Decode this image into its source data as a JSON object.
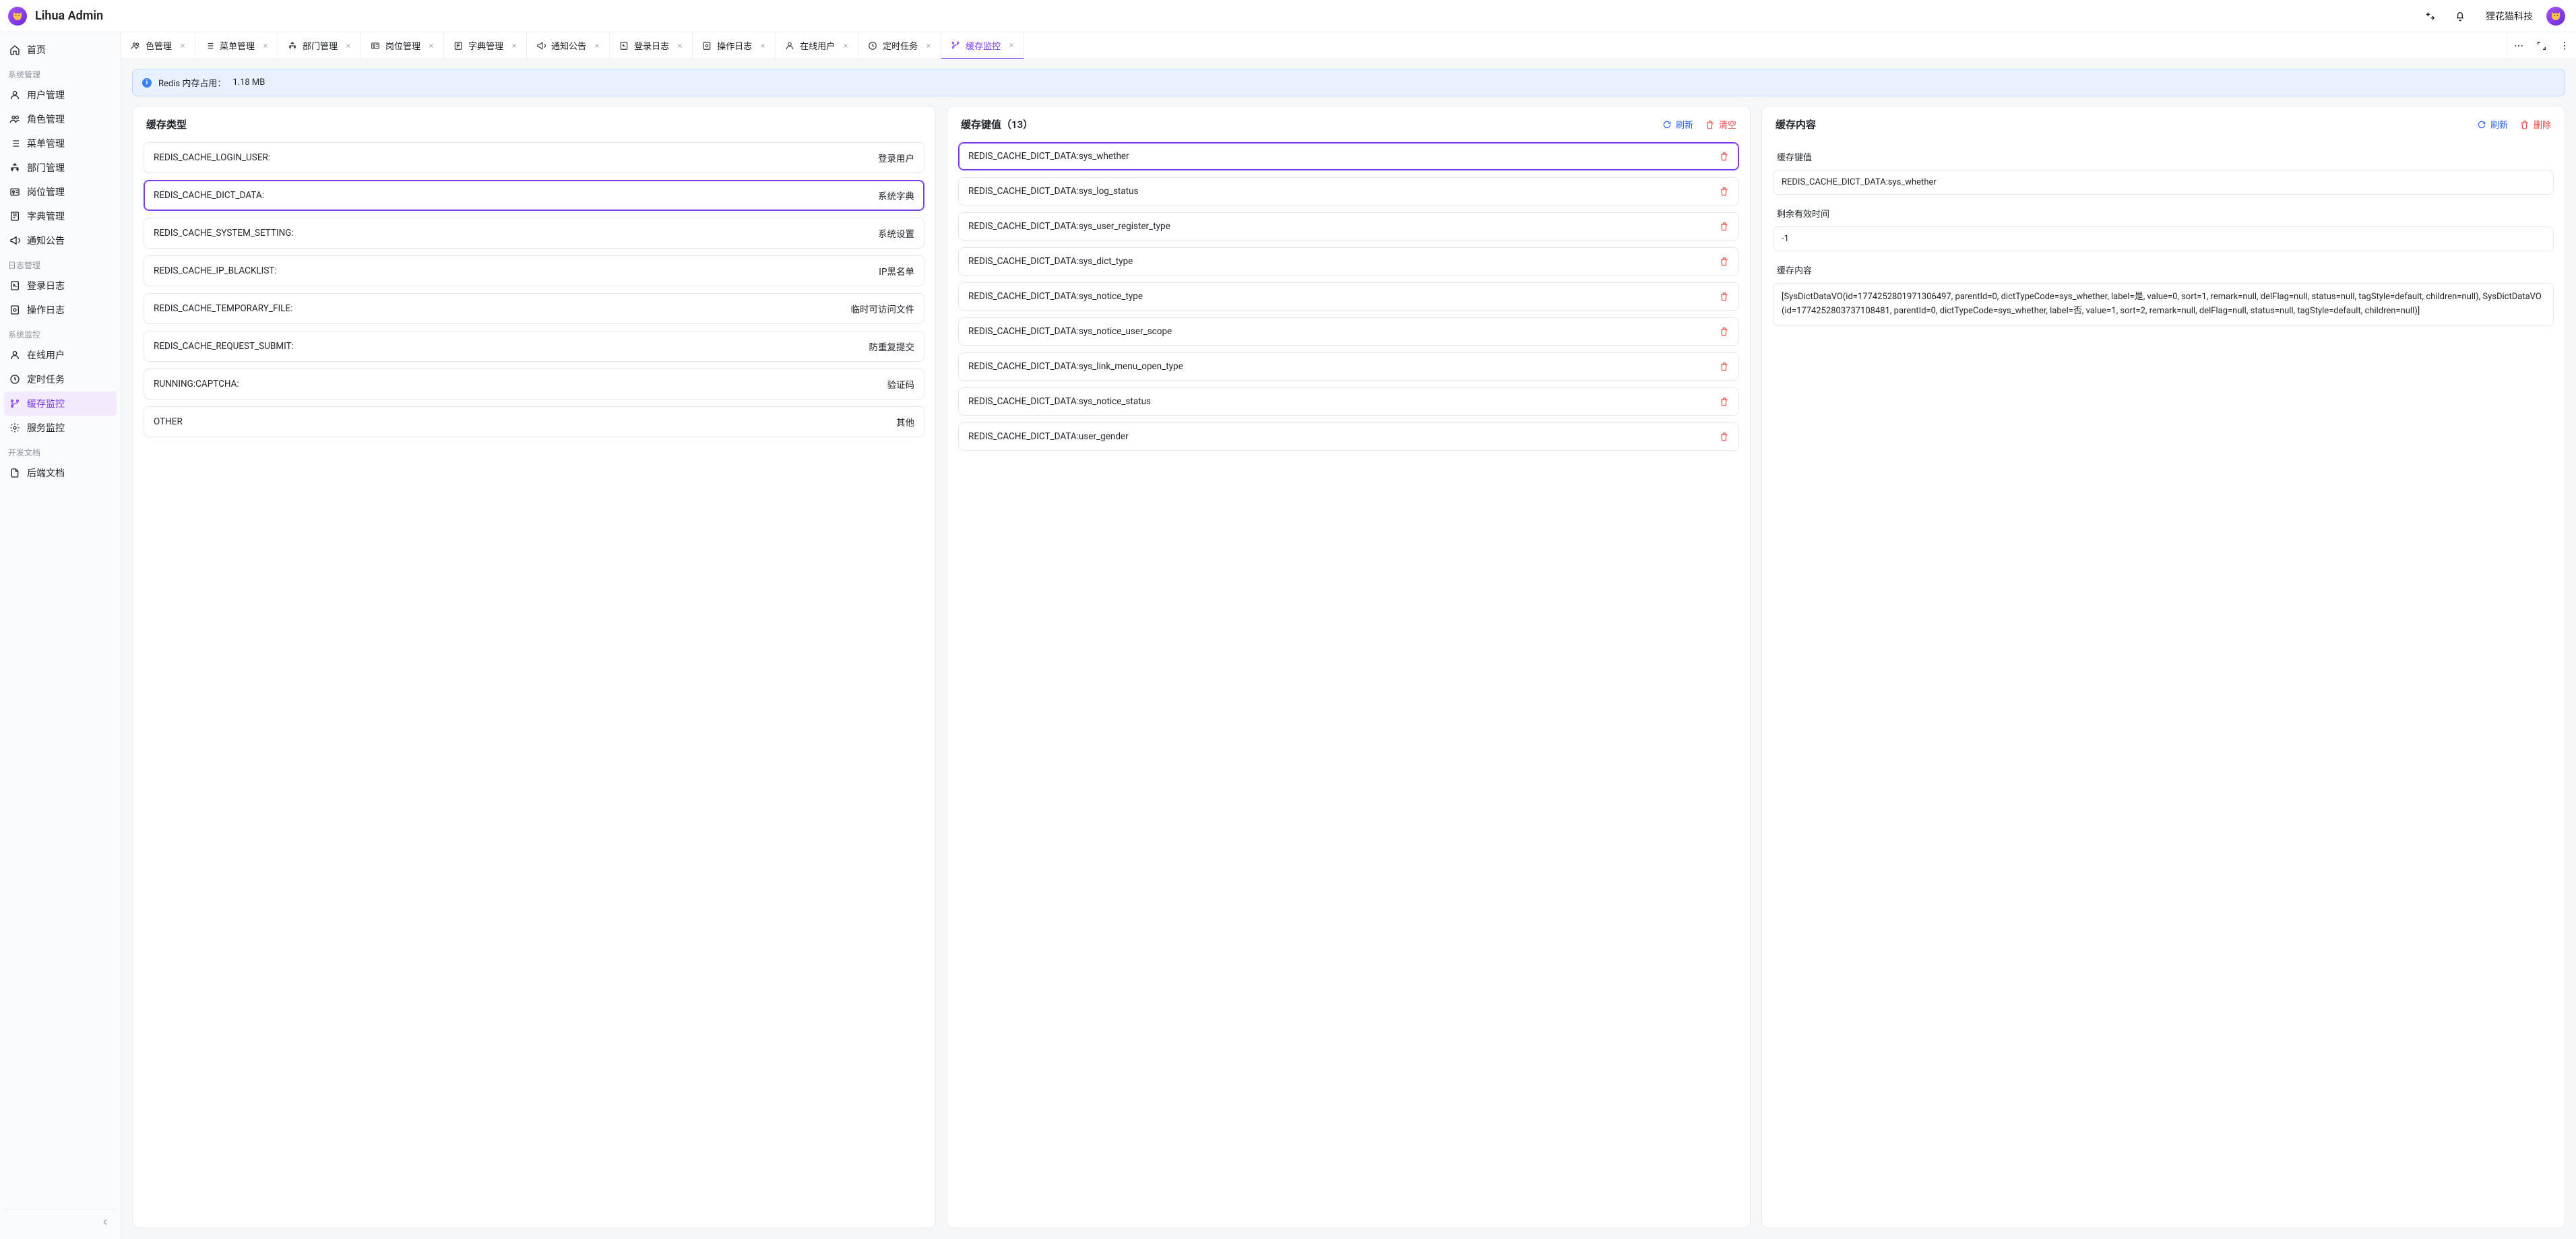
{
  "app": {
    "name": "Lihua Admin",
    "org_name": "狸花猫科技"
  },
  "sidebar": {
    "groups": [
      {
        "title": "",
        "items": [
          {
            "key": "home",
            "label": "首页",
            "icon": "home-icon"
          }
        ]
      },
      {
        "title": "系统管理",
        "items": [
          {
            "key": "user-mgmt",
            "label": "用户管理",
            "icon": "user-icon"
          },
          {
            "key": "role-mgmt",
            "label": "角色管理",
            "icon": "team-icon"
          },
          {
            "key": "menu-mgmt",
            "label": "菜单管理",
            "icon": "list-icon"
          },
          {
            "key": "dept-mgmt",
            "label": "部门管理",
            "icon": "org-icon"
          },
          {
            "key": "post-mgmt",
            "label": "岗位管理",
            "icon": "id-icon"
          },
          {
            "key": "dict-mgmt",
            "label": "字典管理",
            "icon": "dict-icon"
          },
          {
            "key": "notice",
            "label": "通知公告",
            "icon": "notice-icon"
          }
        ]
      },
      {
        "title": "日志管理",
        "items": [
          {
            "key": "login-log",
            "label": "登录日志",
            "icon": "log-icon"
          },
          {
            "key": "op-log",
            "label": "操作日志",
            "icon": "setting-icon"
          }
        ]
      },
      {
        "title": "系统监控",
        "items": [
          {
            "key": "online",
            "label": "在线用户",
            "icon": "user-icon"
          },
          {
            "key": "cron",
            "label": "定时任务",
            "icon": "clock-icon"
          },
          {
            "key": "cache",
            "label": "缓存监控",
            "icon": "branch-icon",
            "active": true
          },
          {
            "key": "server",
            "label": "服务监控",
            "icon": "gear-icon"
          }
        ]
      },
      {
        "title": "开发文档",
        "items": [
          {
            "key": "backend-doc",
            "label": "后端文档",
            "icon": "doc-icon"
          }
        ]
      }
    ]
  },
  "tabs": [
    {
      "key": "role-mgmt",
      "label": "色管理",
      "icon": "team-icon"
    },
    {
      "key": "menu-mgmt",
      "label": "菜单管理",
      "icon": "list-icon"
    },
    {
      "key": "dept-mgmt",
      "label": "部门管理",
      "icon": "org-icon"
    },
    {
      "key": "post-mgmt",
      "label": "岗位管理",
      "icon": "id-icon"
    },
    {
      "key": "dict-mgmt",
      "label": "字典管理",
      "icon": "dict-icon"
    },
    {
      "key": "notice",
      "label": "通知公告",
      "icon": "notice-icon"
    },
    {
      "key": "login-log",
      "label": "登录日志",
      "icon": "log-icon"
    },
    {
      "key": "op-log",
      "label": "操作日志",
      "icon": "setting-icon"
    },
    {
      "key": "online",
      "label": "在线用户",
      "icon": "user-icon"
    },
    {
      "key": "cron",
      "label": "定时任务",
      "icon": "clock-icon"
    },
    {
      "key": "cache",
      "label": "缓存监控",
      "icon": "branch-icon",
      "active": true
    }
  ],
  "alert": {
    "label": "Redis 内存占用：",
    "value": "1.18 MB"
  },
  "panel_types": {
    "title": "缓存类型",
    "items": [
      {
        "key": "REDIS_CACHE_LOGIN_USER:",
        "desc": "登录用户"
      },
      {
        "key": "REDIS_CACHE_DICT_DATA:",
        "desc": "系统字典",
        "selected": true
      },
      {
        "key": "REDIS_CACHE_SYSTEM_SETTING:",
        "desc": "系统设置"
      },
      {
        "key": "REDIS_CACHE_IP_BLACKLIST:",
        "desc": "IP黑名单"
      },
      {
        "key": "REDIS_CACHE_TEMPORARY_FILE:",
        "desc": "临时可访问文件"
      },
      {
        "key": "REDIS_CACHE_REQUEST_SUBMIT:",
        "desc": "防重复提交"
      },
      {
        "key": "RUNNING:CAPTCHA:",
        "desc": "验证码"
      },
      {
        "key": "OTHER",
        "desc": "其他"
      }
    ]
  },
  "panel_keys": {
    "title_prefix": "缓存键值",
    "count_formatted": "（13）",
    "refresh_label": "刷新",
    "clear_label": "清空",
    "items": [
      {
        "key": "REDIS_CACHE_DICT_DATA:sys_whether",
        "selected": true
      },
      {
        "key": "REDIS_CACHE_DICT_DATA:sys_log_status"
      },
      {
        "key": "REDIS_CACHE_DICT_DATA:sys_user_register_type"
      },
      {
        "key": "REDIS_CACHE_DICT_DATA:sys_dict_type"
      },
      {
        "key": "REDIS_CACHE_DICT_DATA:sys_notice_type"
      },
      {
        "key": "REDIS_CACHE_DICT_DATA:sys_notice_user_scope"
      },
      {
        "key": "REDIS_CACHE_DICT_DATA:sys_link_menu_open_type"
      },
      {
        "key": "REDIS_CACHE_DICT_DATA:sys_notice_status"
      },
      {
        "key": "REDIS_CACHE_DICT_DATA:user_gender"
      }
    ]
  },
  "panel_detail": {
    "title": "缓存内容",
    "refresh_label": "刷新",
    "delete_label": "删除",
    "sections": {
      "key_label": "缓存键值",
      "key_value": "REDIS_CACHE_DICT_DATA:sys_whether",
      "ttl_label": "剩余有效时间",
      "ttl_value": "-1",
      "content_label": "缓存内容",
      "content_value": "[SysDictDataVO(id=1774252801971306497, parentId=0, dictTypeCode=sys_whether, label=是, value=0, sort=1, remark=null, delFlag=null, status=null, tagStyle=default, children=null), SysDictDataVO(id=1774252803737108481, parentId=0, dictTypeCode=sys_whether, label=否, value=1, sort=2, remark=null, delFlag=null, status=null, tagStyle=default, children=null)]"
    }
  }
}
